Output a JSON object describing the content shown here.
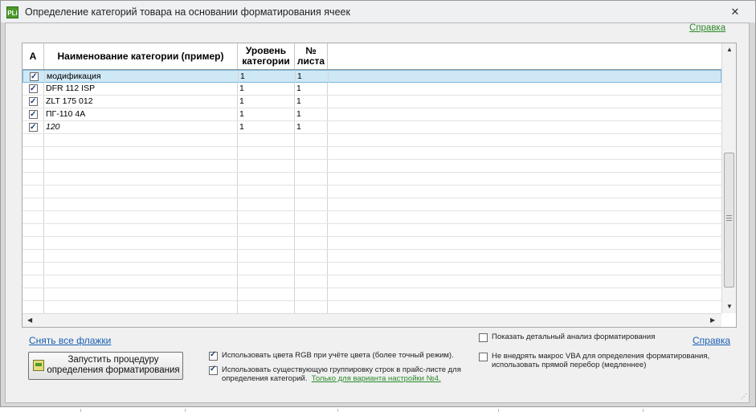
{
  "window": {
    "title": "Определение категорий товара на основании форматирования ячеек",
    "icon_label": "PLi",
    "close_glyph": "✕"
  },
  "help_top": "Справка",
  "grid": {
    "columns": {
      "a": "A",
      "name": "Наименование категории (пример)",
      "level": "Уровень категории",
      "sheet": "№ листа"
    },
    "rows": [
      {
        "checked": true,
        "name": "модификация",
        "level": "1",
        "sheet": "1",
        "italic": false,
        "selected": true
      },
      {
        "checked": true,
        "name": "DFR 112 ISP",
        "level": "1",
        "sheet": "1",
        "italic": false,
        "selected": false
      },
      {
        "checked": true,
        "name": "ZLT 175 012",
        "level": "1",
        "sheet": "1",
        "italic": false,
        "selected": false
      },
      {
        "checked": true,
        "name": "ПГ-110 4А",
        "level": "1",
        "sheet": "1",
        "italic": false,
        "selected": false
      },
      {
        "checked": true,
        "name": "120",
        "level": "1",
        "sheet": "1",
        "italic": true,
        "selected": false
      }
    ]
  },
  "clear_flags": "Снять все флажки",
  "run_button": {
    "line1": "Запустить процедуру",
    "line2": "определения форматирования"
  },
  "options": {
    "use_rgb": {
      "checked": true,
      "label": "Использовать цвета RGB при учёте цвета (более точный режим)."
    },
    "use_grouping": {
      "checked": true,
      "label_line1": "Использовать существующую группировку строк в прайс-листе для",
      "label_line2": "определения категорий.",
      "note": "Только для варианта настройки №4."
    },
    "show_detail": {
      "checked": false,
      "label": "Показать детальный анализ форматирования"
    },
    "no_vba": {
      "checked": false,
      "label_line1": "Не внедрять макрос VBA для определения форматирования,",
      "label_line2": "использовать прямой перебор (медленнее)"
    }
  },
  "help_bottom": "Справка",
  "icons": {
    "scroll_up": "▲",
    "scroll_down": "▼",
    "scroll_left": "◀",
    "scroll_right": "▶",
    "resize_grip": "⋰"
  }
}
